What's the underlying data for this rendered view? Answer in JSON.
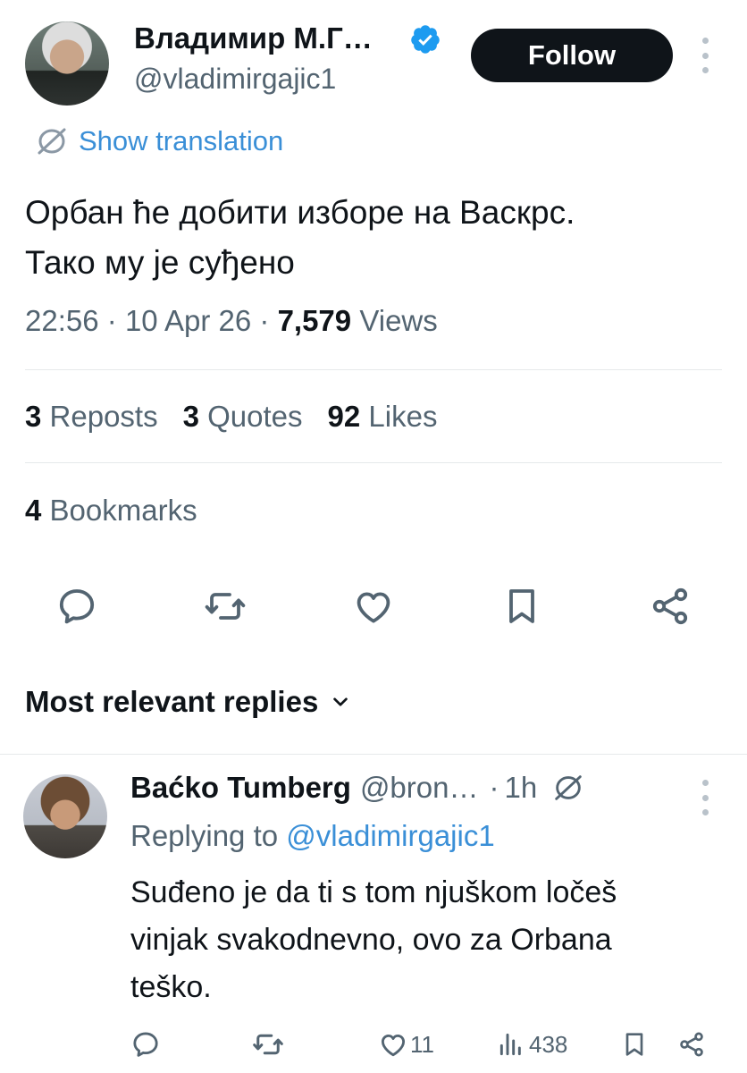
{
  "tweet": {
    "author_name": "Владимир М.Г…",
    "author_handle": "@vladimirgajic1",
    "follow_label": "Follow",
    "translate_label": "Show translation",
    "text_line1": "Орбан ће добити изборе на Васкрс.",
    "text_line2": "Тако му је суђено",
    "time": "22:56",
    "date": "10 Apr 26",
    "views_count": "7,579",
    "views_label": "Views",
    "reposts_count": "3",
    "reposts_label": "Reposts",
    "quotes_count": "3",
    "quotes_label": "Quotes",
    "likes_count": "92",
    "likes_label": "Likes",
    "bookmarks_count": "4",
    "bookmarks_label": "Bookmarks",
    "sep": "·"
  },
  "replies_section": {
    "title": "Most relevant replies"
  },
  "reply": {
    "author_name": "Baćko Tumberg",
    "author_handle": "@bron…",
    "time": "1h",
    "replying_prefix": "Replying to",
    "replying_to": "@vladimirgajic1",
    "text_line1": "Suđeno je da ti s tom njuškom ločeš",
    "text_line2": "vinjak svakodnevno, ovo za Orbana",
    "text_line3": "teško.",
    "likes": "11",
    "views": "438"
  },
  "colors": {
    "accent": "#1d9bf0",
    "link": "#3a8fd7",
    "text": "#0f1419",
    "muted": "#536471"
  }
}
